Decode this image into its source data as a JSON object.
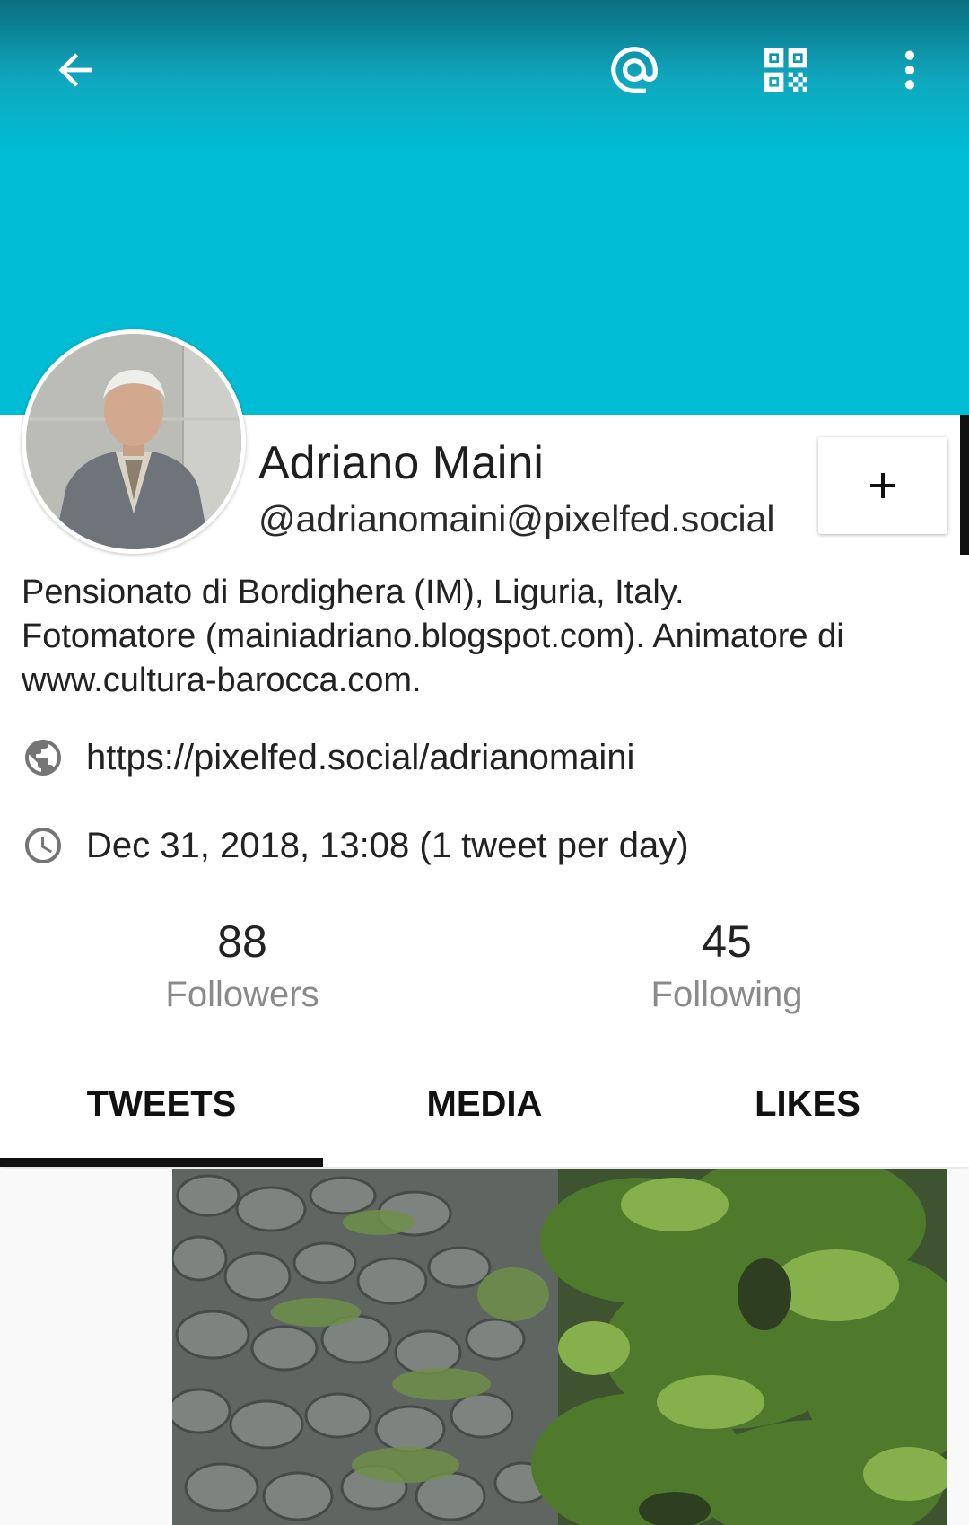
{
  "toolbar": {
    "back_icon": "arrow-left-icon",
    "mention_icon": "at-sign-icon",
    "qr_icon": "qr-code-icon",
    "more_icon": "more-vertical-icon"
  },
  "profile": {
    "display_name": "Adriano Maini",
    "handle": "@adrianomaini@pixelfed.social",
    "follow_button_symbol": "+",
    "bio_lines": [
      "Pensionato di Bordighera (IM), Liguria, Italy.",
      "Fotomatore (mainiadriano.blogspot.com). Animatore di",
      "www.cultura-barocca.com."
    ],
    "url": "https://pixelfed.social/adrianomaini",
    "joined": "Dec 31, 2018, 13:08 (1 tweet per day)"
  },
  "stats": {
    "followers_count": "88",
    "followers_label": "Followers",
    "following_count": "45",
    "following_label": "Following"
  },
  "tabs": [
    {
      "label": "TWEETS",
      "selected": true
    },
    {
      "label": "MEDIA",
      "selected": false
    },
    {
      "label": "LIKES",
      "selected": false
    }
  ],
  "colors": {
    "banner": "#00bcd4",
    "tab_indicator": "#111111",
    "secondary_text": "#8a8a8a"
  }
}
